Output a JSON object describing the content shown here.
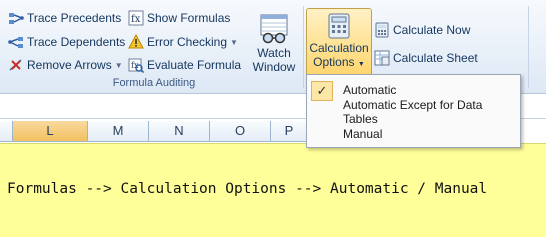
{
  "formula_auditing": {
    "trace_precedents": "Trace Precedents",
    "trace_dependents": "Trace Dependents",
    "remove_arrows": "Remove Arrows",
    "show_formulas": "Show Formulas",
    "error_checking": "Error Checking",
    "evaluate_formula": "Evaluate Formula",
    "watch_line1": "Watch",
    "watch_line2": "Window",
    "group_label": "Formula Auditing"
  },
  "calculation": {
    "options_line1": "Calculation",
    "options_line2": "Options",
    "calculate_now": "Calculate Now",
    "calculate_sheet": "Calculate Sheet",
    "menu_items": [
      "Automatic",
      "Automatic Except for Data Tables",
      "Manual"
    ],
    "selected_item": "Automatic"
  },
  "columns": [
    "L",
    "M",
    "N",
    "O",
    "P"
  ],
  "banner_text": "Formulas --> Calculation Options --> Automatic / Manual",
  "colors": {
    "highlight": "#ffff99",
    "ribbon": "#dde8f5",
    "selected_button": "#ffd56b"
  }
}
